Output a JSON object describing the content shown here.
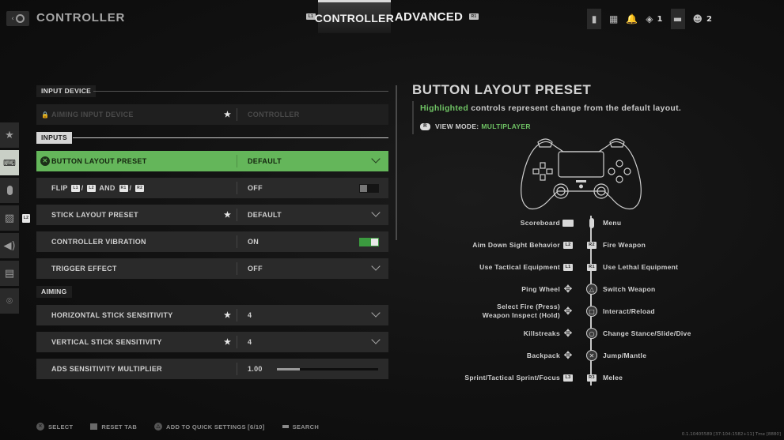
{
  "header": {
    "title": "CONTROLLER",
    "back_icon": "back-eye-icon",
    "tabs": [
      {
        "label": "CONTROLLER",
        "hint": "L1",
        "active": true
      },
      {
        "label": "ADVANCED",
        "hint": "R1",
        "active": false
      }
    ],
    "status_icons": [
      {
        "name": "controller-battery-icon",
        "count": null
      },
      {
        "name": "grid-menu-icon",
        "count": null
      },
      {
        "name": "bell-icon",
        "count": null
      },
      {
        "name": "rank-emblem-icon",
        "count": "1"
      },
      {
        "name": "player-card-icon",
        "count": null
      },
      {
        "name": "party-icon",
        "count": "2"
      }
    ]
  },
  "side_nav": [
    {
      "name": "favorites",
      "glyph": "★"
    },
    {
      "name": "controller",
      "glyph": "🎮",
      "active": true
    },
    {
      "name": "mouse",
      "glyph": "▯"
    },
    {
      "name": "graphics",
      "glyph": "▨"
    },
    {
      "name": "audio",
      "glyph": "🔊"
    },
    {
      "name": "interface",
      "glyph": "▤"
    },
    {
      "name": "network",
      "glyph": "⌾"
    }
  ],
  "side_hint": "L2",
  "sections": {
    "input_device": "INPUT DEVICE",
    "inputs": "INPUTS",
    "aiming": "AIMING"
  },
  "rows": {
    "aiming_input_device": {
      "label": "AIMING INPUT DEVICE",
      "value": "CONTROLLER",
      "starred": true,
      "disabled": true
    },
    "button_layout_preset": {
      "label": "BUTTON LAYOUT PRESET",
      "value": "DEFAULT",
      "selected": true
    },
    "flip": {
      "label_parts": [
        "FLIP",
        "L1",
        "/",
        "L2",
        "AND",
        "R1",
        "/",
        "R2"
      ],
      "value": "OFF",
      "toggle": false
    },
    "stick_layout_preset": {
      "label": "STICK LAYOUT PRESET",
      "value": "DEFAULT",
      "starred": true
    },
    "controller_vibration": {
      "label": "CONTROLLER VIBRATION",
      "value": "ON",
      "toggle": true
    },
    "trigger_effect": {
      "label": "TRIGGER EFFECT",
      "value": "OFF"
    },
    "horizontal_sensitivity": {
      "label": "HORIZONTAL STICK SENSITIVITY",
      "value": "4",
      "starred": true
    },
    "vertical_sensitivity": {
      "label": "VERTICAL STICK SENSITIVITY",
      "value": "4",
      "starred": true
    },
    "ads_multiplier": {
      "label": "ADS SENSITIVITY MULTIPLIER",
      "value": "1.00",
      "slider_fraction": 0.23
    }
  },
  "right_panel": {
    "title": "BUTTON LAYOUT PRESET",
    "desc_highlight": "Highlighted",
    "desc_rest": " controls represent change from the default layout.",
    "view_button": "R",
    "view_label": "VIEW MODE:",
    "view_mode": "MULTIPLAYER",
    "mappings": [
      {
        "left": "Scoreboard",
        "left_glyph": "touchpad",
        "right": "Menu",
        "right_glyph": "options"
      },
      {
        "left": "Aim Down Sight Behavior",
        "left_glyph": "L2",
        "right": "Fire Weapon",
        "right_glyph": "R2"
      },
      {
        "left": "Use Tactical Equipment",
        "left_glyph": "L1",
        "right": "Use Lethal Equipment",
        "right_glyph": "R1"
      },
      {
        "left": "Ping Wheel",
        "left_glyph": "dpad-up",
        "right": "Switch Weapon",
        "right_glyph": "△"
      },
      {
        "left": "Select Fire (Press)",
        "left2": "Weapon Inspect (Hold)",
        "left_glyph": "dpad-left",
        "right": "Interact/Reload",
        "right_glyph": "□"
      },
      {
        "left": "Killstreaks",
        "left_glyph": "dpad-right",
        "right": "Change Stance/Slide/Dive",
        "right_glyph": "○"
      },
      {
        "left": "Backpack",
        "left_glyph": "dpad-down",
        "right": "Jump/Mantle",
        "right_glyph": "✕"
      },
      {
        "left": "Sprint/Tactical Sprint/Focus",
        "left_glyph": "L3",
        "right": "Melee",
        "right_glyph": "R3"
      }
    ]
  },
  "footer": [
    {
      "icon": "cross-button-icon",
      "label": "SELECT"
    },
    {
      "icon": "reset-button-icon",
      "label": "RESET TAB"
    },
    {
      "icon": "triangle-button-icon",
      "label": "ADD TO QUICK SETTINGS [6/10]"
    },
    {
      "icon": "touchpad-button-icon",
      "label": "SEARCH"
    }
  ],
  "version": "0.1.10405589 [37:104:1582+11] Tme [8880]"
}
